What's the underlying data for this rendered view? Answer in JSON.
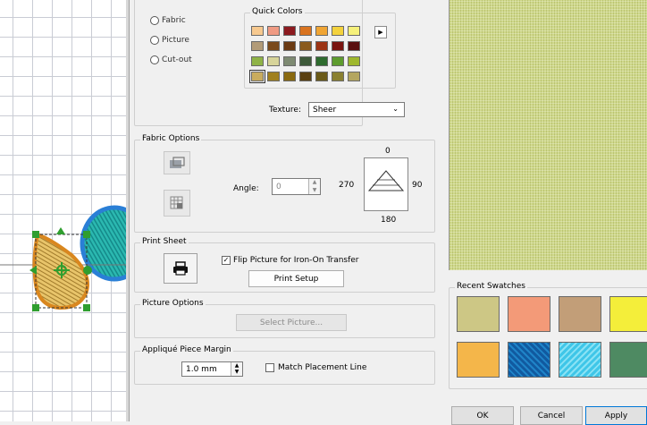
{
  "fill_type": {
    "options": [
      "Fabric",
      "Picture",
      "Cut-out"
    ]
  },
  "quick_colors": {
    "title": "Quick Colors",
    "rows": [
      [
        "#f7c98f",
        "#ef9a83",
        "#8c1a1f",
        "#d9731f",
        "#f0a534",
        "#f4d23d",
        "#f6f17b"
      ],
      [
        "#b29b78",
        "#7a4a1c",
        "#6b3a12",
        "#8a5a1c",
        "#9c3414",
        "#7a1410",
        "#5a1010"
      ],
      [
        "#8fb347",
        "#d7d49a",
        "#7e8a72",
        "#3e5a3a",
        "#2e6b2e",
        "#5e9c2e",
        "#9fb82e"
      ],
      [
        "#c9ac5e",
        "#a0801e",
        "#8a6a10",
        "#5a4010",
        "#6a5a18",
        "#8a8030",
        "#b4a660"
      ]
    ],
    "selected": "#c9ac5e",
    "more_icon": "triangle-right-icon"
  },
  "texture": {
    "label": "Texture:",
    "value": "Sheer"
  },
  "fabric_options": {
    "title": "Fabric Options",
    "angle_label": "Angle:",
    "angle_value": "0",
    "dial": {
      "top": "0",
      "left": "270",
      "right": "90",
      "bottom": "180"
    }
  },
  "print_sheet": {
    "title": "Print Sheet",
    "flip_label": "Flip Picture for Iron-On Transfer",
    "flip_checked": true,
    "print_setup_label": "Print Setup"
  },
  "picture_options": {
    "title": "Picture Options",
    "select_picture_label": "Select Picture..."
  },
  "margin": {
    "title": "Appliqué Piece Margin",
    "value": "1.0 mm",
    "match_label": "Match Placement Line",
    "match_checked": false
  },
  "recent_swatches": {
    "title": "Recent Swatches"
  },
  "buttons": {
    "ok": "OK",
    "cancel": "Cancel",
    "apply": "Apply"
  }
}
